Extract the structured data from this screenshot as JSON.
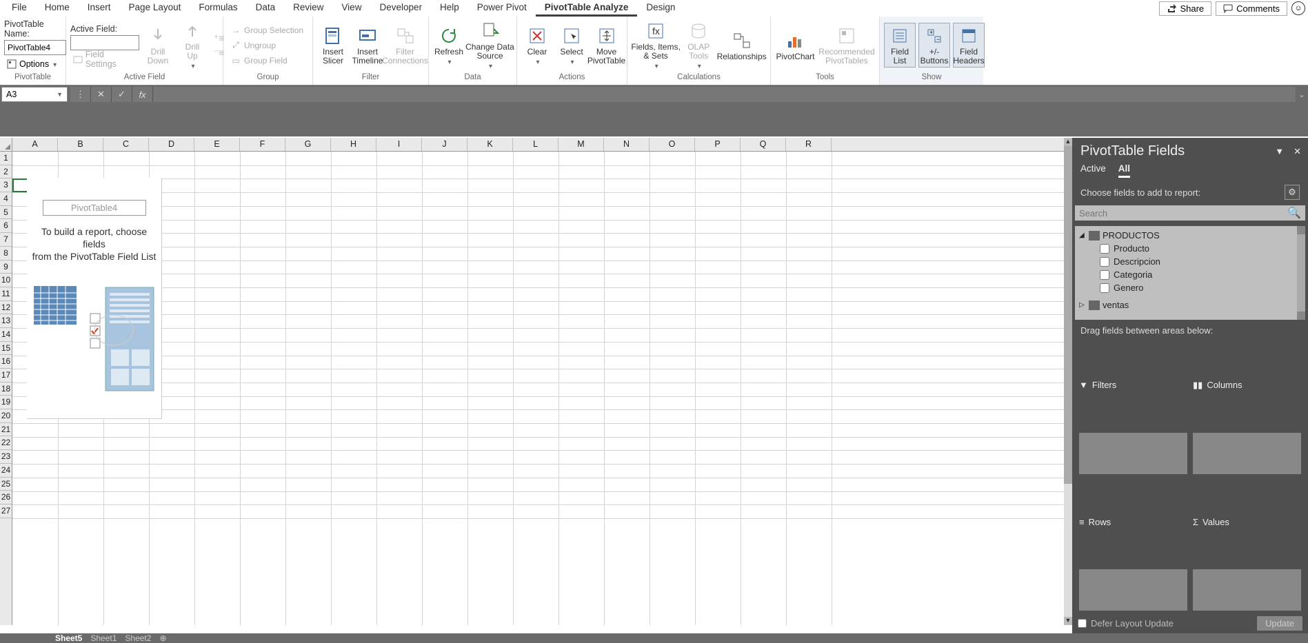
{
  "tabs": [
    "File",
    "Home",
    "Insert",
    "Page Layout",
    "Formulas",
    "Data",
    "Review",
    "View",
    "Developer",
    "Help",
    "Power Pivot",
    "PivotTable Analyze",
    "Design"
  ],
  "active_tab": "PivotTable Analyze",
  "top_right": {
    "share": "Share",
    "comments": "Comments"
  },
  "ribbon": {
    "pivot_table": {
      "name_label": "PivotTable Name:",
      "name_value": "PivotTable4",
      "options": "Options",
      "group": "PivotTable"
    },
    "active_field": {
      "label": "Active Field:",
      "value": "",
      "field_settings": "Field Settings",
      "drill_down": "Drill\nDown",
      "drill_up": "Drill\nUp",
      "group": "Active Field"
    },
    "group": {
      "selection": "Group Selection",
      "ungroup": "Ungroup",
      "field": "Group Field",
      "group": "Group"
    },
    "filter": {
      "insert_slicer": "Insert\nSlicer",
      "insert_timeline": "Insert\nTimeline",
      "filter_conn": "Filter\nConnections",
      "group": "Filter"
    },
    "data": {
      "refresh": "Refresh",
      "change_ds": "Change Data\nSource",
      "group": "Data"
    },
    "actions": {
      "clear": "Clear",
      "select": "Select",
      "move": "Move\nPivotTable",
      "group": "Actions"
    },
    "calc": {
      "fields": "Fields, Items,\n& Sets",
      "olap": "OLAP\nTools",
      "rel": "Relationships",
      "group": "Calculations"
    },
    "tools": {
      "chart": "PivotChart",
      "recommended": "Recommended\nPivotTables",
      "group": "Tools"
    },
    "show": {
      "field_list": "Field\nList",
      "buttons": "+/-\nButtons",
      "headers": "Field\nHeaders",
      "group": "Show"
    }
  },
  "name_box": "A3",
  "columns": [
    "A",
    "B",
    "C",
    "D",
    "E",
    "F",
    "G",
    "H",
    "I",
    "J",
    "K",
    "L",
    "M",
    "N",
    "O",
    "P",
    "Q",
    "R"
  ],
  "rows": [
    "1",
    "2",
    "3",
    "4",
    "5",
    "6",
    "7",
    "8",
    "9",
    "10",
    "11",
    "12",
    "13",
    "14",
    "15",
    "16",
    "17",
    "18",
    "19",
    "20",
    "21",
    "22",
    "23",
    "24",
    "25",
    "26",
    "27"
  ],
  "pivot_placeholder": {
    "title": "PivotTable4",
    "msg1": "To build a report, choose fields",
    "msg2": "from the PivotTable Field List"
  },
  "pane": {
    "title": "PivotTable Fields",
    "tabs": {
      "active": "Active",
      "all": "All"
    },
    "hint": "Choose fields to add to report:",
    "search_placeholder": "Search",
    "tables": [
      {
        "name": "PRODUCTOS",
        "expanded": true,
        "fields": [
          "Producto",
          "Descripcion",
          "Categoria",
          "Genero"
        ]
      },
      {
        "name": "ventas",
        "expanded": false,
        "fields": []
      }
    ],
    "drag_hint": "Drag fields between areas below:",
    "areas": {
      "filters": "Filters",
      "columns": "Columns",
      "rows": "Rows",
      "values": "Values"
    },
    "defer": "Defer Layout Update",
    "update": "Update"
  },
  "sheets": [
    "Sheet5",
    "Sheet1",
    "Sheet2"
  ]
}
